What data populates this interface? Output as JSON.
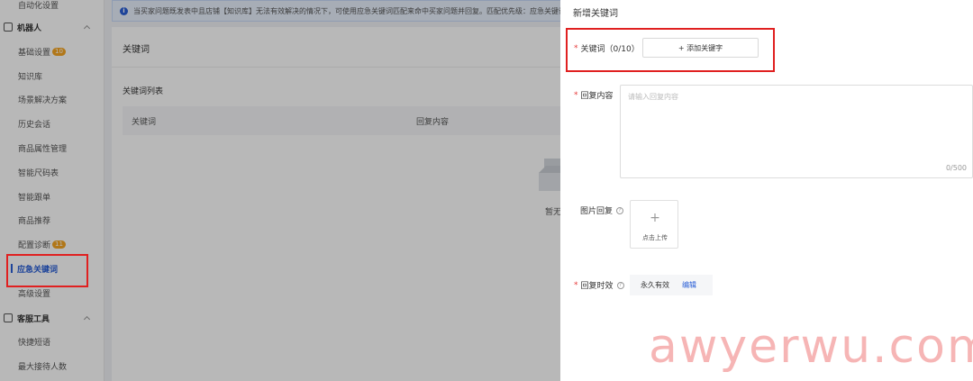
{
  "sidebar": {
    "items": [
      {
        "label": "自动化设置",
        "type": "item",
        "badge": ""
      },
      {
        "label": "机器人",
        "type": "group",
        "badge": ""
      },
      {
        "label": "基础设置",
        "type": "item",
        "badge": "10"
      },
      {
        "label": "知识库",
        "type": "item",
        "badge": ""
      },
      {
        "label": "场景解决方案",
        "type": "item",
        "badge": ""
      },
      {
        "label": "历史会话",
        "type": "item",
        "badge": ""
      },
      {
        "label": "商品属性管理",
        "type": "item",
        "badge": ""
      },
      {
        "label": "智能尺码表",
        "type": "item",
        "badge": ""
      },
      {
        "label": "智能跟单",
        "type": "item",
        "badge": ""
      },
      {
        "label": "商品推荐",
        "type": "item",
        "badge": ""
      },
      {
        "label": "配置诊断",
        "type": "item",
        "badge": "11"
      },
      {
        "label": "应急关键词",
        "type": "active",
        "badge": ""
      },
      {
        "label": "高级设置",
        "type": "item",
        "badge": ""
      },
      {
        "label": "客服工具",
        "type": "group",
        "badge": ""
      },
      {
        "label": "快捷短语",
        "type": "item",
        "badge": ""
      },
      {
        "label": "最大接待人数",
        "type": "item",
        "badge": ""
      }
    ]
  },
  "notice": {
    "text": "当买家问题既发表中且店铺【知识库】无法有效解决的情况下，可使用应急关键词匹配来命中买家问题并回复。匹配优先级：应急关键词 > 店铺知识库"
  },
  "main": {
    "title": "关键词",
    "list_title": "关键词列表",
    "columns": [
      "关键词",
      "回复内容"
    ],
    "empty_text": "暂无"
  },
  "drawer": {
    "title": "新增关键词",
    "keyword_label": "关键词（0/10）",
    "add_button": "+ 添加关键字",
    "reply_label": "回复内容",
    "reply_placeholder": "请输入回复内容",
    "reply_count": "0/500",
    "image_label": "图片回复",
    "upload_plus": "+",
    "upload_text": "点击上传",
    "effect_label": "回复时效",
    "effect_value": "永久有效",
    "effect_edit": "编辑"
  },
  "watermark": "awyerwu.com",
  "colors": {
    "accent": "#2a5fd6",
    "highlight": "#e02020",
    "badge": "#f5a623"
  }
}
